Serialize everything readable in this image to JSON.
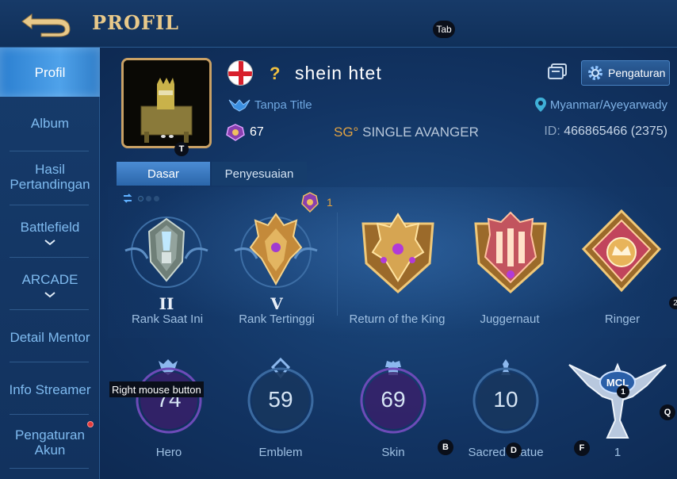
{
  "header": {
    "title": "PROFIL",
    "tab_hint": "Tab"
  },
  "sidebar": {
    "items": [
      {
        "label": "Profil",
        "active": true
      },
      {
        "label": "Album"
      },
      {
        "label": "Hasil Pertandingan"
      },
      {
        "label": "Battlefield",
        "dropdown": true
      },
      {
        "label": "ARCADE",
        "dropdown": true
      },
      {
        "label": "Detail Mentor"
      },
      {
        "label": "Info Streamer"
      },
      {
        "label": "Pengaturan Akun",
        "notification": true
      }
    ]
  },
  "profile": {
    "username": "shein htet",
    "unknown_mark": "?",
    "title": "Tanpa Title",
    "level": "67",
    "squad_tag": "SG°",
    "squad_name": "SINGLE AVANGER",
    "location": "Myanmar/Ayeyarwady",
    "id_label": "ID:",
    "id_value": "466865466 (2375)",
    "settings_label": "Pengaturan",
    "avatar_hint": "T"
  },
  "tabs": [
    {
      "label": "Dasar",
      "active": true
    },
    {
      "label": "Penyesuaian"
    }
  ],
  "ranks": {
    "badge_count": "1",
    "items": [
      {
        "roman": "II",
        "label": "Rank Saat Ini"
      },
      {
        "roman": "V",
        "label": "Rank Tertinggi"
      },
      {
        "label": "Return of the King"
      },
      {
        "label": "Juggernaut"
      },
      {
        "label": "Ringer"
      }
    ],
    "side_hint": "2"
  },
  "stats": [
    {
      "value": "74",
      "label": "Hero"
    },
    {
      "value": "59",
      "label": "Emblem"
    },
    {
      "value": "69",
      "label": "Skin"
    },
    {
      "value": "10",
      "label": "Sacred Statue"
    },
    {
      "value": "1",
      "label": ""
    }
  ],
  "hints": {
    "right_mouse": "Right mouse button",
    "b": "B",
    "d": "D",
    "f": "F",
    "q": "Q",
    "one": "1"
  },
  "colors": {
    "accent_gold": "#e8c98a",
    "active_blue": "#4fa2ea",
    "background": "#123463"
  }
}
